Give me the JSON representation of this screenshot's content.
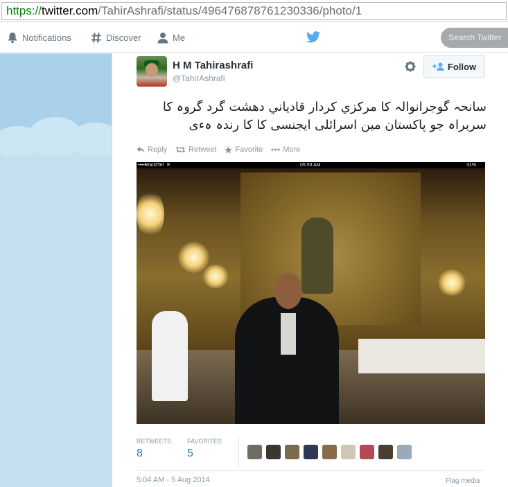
{
  "browser": {
    "url_scheme": "https://",
    "url_host": "twitter.com",
    "url_path": "/TahirAshrafi/status/496476878761230336/photo/1"
  },
  "nav": {
    "notifications": "Notifications",
    "discover": "Discover",
    "me": "Me",
    "search_placeholder": "Search Twitter"
  },
  "tweet": {
    "fullname": "H M Tahirashrafi",
    "username": "@TahirAshrafi",
    "follow_label": "Follow",
    "text": "سانحہ گوجرانوالہ کا مرکزي کردار قادياني دھشت گرد گروہ کا سربراہ جو پاکستان مین اسرائلی ایجنسی کا کا رندہ ہءی",
    "actions": {
      "reply": "Reply",
      "retweet": "Retweet",
      "favorite": "Favorite",
      "more": "More"
    },
    "photo_status": {
      "carrier": "WaridTel",
      "signal_dots": "•••••",
      "network": "E",
      "time": "05:53 AM",
      "battery": "31%"
    },
    "stats": {
      "retweets_label": "RETWEETS",
      "retweets_count": "8",
      "favorites_label": "FAVORITES",
      "favorites_count": "5"
    },
    "favoriter_colors": [
      "#6f6c63",
      "#3a3630",
      "#7a6b4f",
      "#2e3a55",
      "#8a6a49",
      "#cfc6b5",
      "#b34a5a",
      "#4a3e33",
      "#9aa9b8"
    ],
    "timestamp": "5:04 AM - 5 Aug 2014",
    "flag_label": "Flag media"
  },
  "colors": {
    "twitter_blue": "#55acee",
    "link_blue": "#2b7bb9",
    "background_blue": "#a9d2ea"
  }
}
